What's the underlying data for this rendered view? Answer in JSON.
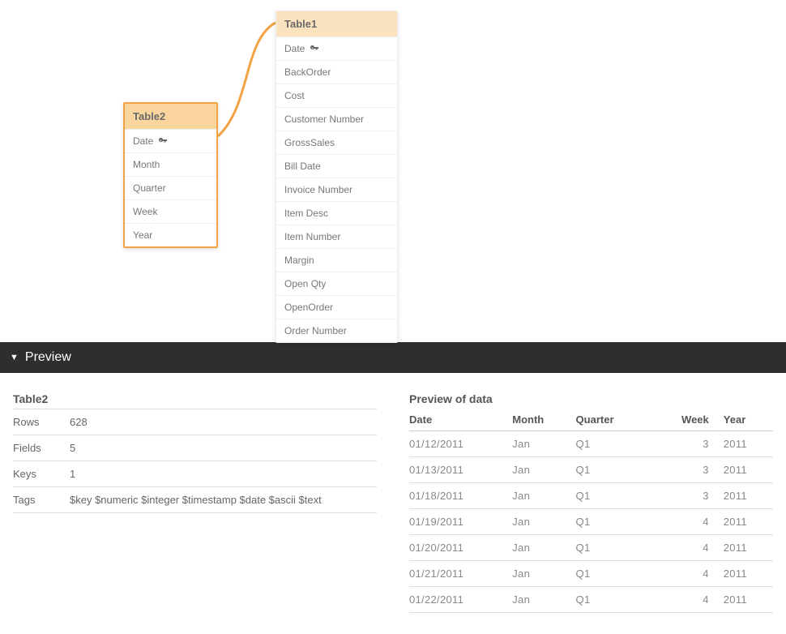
{
  "tables": {
    "table1": {
      "name": "Table1",
      "fields": [
        {
          "label": "Date",
          "key": true
        },
        {
          "label": "BackOrder",
          "key": false
        },
        {
          "label": "Cost",
          "key": false
        },
        {
          "label": "Customer Number",
          "key": false
        },
        {
          "label": "GrossSales",
          "key": false
        },
        {
          "label": "Bill Date",
          "key": false
        },
        {
          "label": "Invoice Number",
          "key": false
        },
        {
          "label": "Item Desc",
          "key": false
        },
        {
          "label": "Item Number",
          "key": false
        },
        {
          "label": "Margin",
          "key": false
        },
        {
          "label": "Open Qty",
          "key": false
        },
        {
          "label": "OpenOrder",
          "key": false
        },
        {
          "label": "Order Number",
          "key": false
        }
      ]
    },
    "table2": {
      "name": "Table2",
      "fields": [
        {
          "label": "Date",
          "key": true
        },
        {
          "label": "Month",
          "key": false
        },
        {
          "label": "Quarter",
          "key": false
        },
        {
          "label": "Week",
          "key": false
        },
        {
          "label": "Year",
          "key": false
        }
      ]
    }
  },
  "preview": {
    "header": "Preview",
    "info": {
      "title": "Table2",
      "rows_label": "Rows",
      "rows_value": "628",
      "fields_label": "Fields",
      "fields_value": "5",
      "keys_label": "Keys",
      "keys_value": "1",
      "tags_label": "Tags",
      "tags_value": "$key $numeric $integer $timestamp $date $ascii $text"
    },
    "data": {
      "title": "Preview of data",
      "columns": [
        "Date",
        "Month",
        "Quarter",
        "Week",
        "Year"
      ],
      "rows": [
        [
          "01/12/2011",
          "Jan",
          "Q1",
          "3",
          "2011"
        ],
        [
          "01/13/2011",
          "Jan",
          "Q1",
          "3",
          "2011"
        ],
        [
          "01/18/2011",
          "Jan",
          "Q1",
          "3",
          "2011"
        ],
        [
          "01/19/2011",
          "Jan",
          "Q1",
          "4",
          "2011"
        ],
        [
          "01/20/2011",
          "Jan",
          "Q1",
          "4",
          "2011"
        ],
        [
          "01/21/2011",
          "Jan",
          "Q1",
          "4",
          "2011"
        ],
        [
          "01/22/2011",
          "Jan",
          "Q1",
          "4",
          "2011"
        ]
      ]
    }
  }
}
